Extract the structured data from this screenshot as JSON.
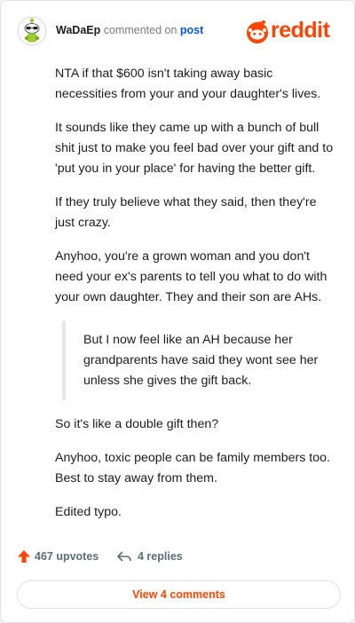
{
  "header": {
    "username": "WaDaEp",
    "action": "commented on",
    "link": "post",
    "logo_text": "reddit"
  },
  "comment": {
    "paragraphs": [
      "NTA if that $600 isn't taking away basic necessities from your and your daughter's lives.",
      "It sounds like they came up with a bunch of bull shit just to make you feel bad over your gift and to 'put you in your place' for having the better gift.",
      "If they truly believe what they said, then they're just crazy.",
      "Anyhoo, you're a grown woman and you don't need your ex's parents to tell you what to do with your own daughter. They and their son are AHs."
    ],
    "quote": "But I now feel like an AH because her grandparents have said they wont see her unless she gives the gift back.",
    "paragraphs_after": [
      "So it's like a double gift then?",
      "Anyhoo, toxic people can be family members too. Best to stay away from them.",
      "Edited typo."
    ]
  },
  "footer": {
    "upvotes": "467 upvotes",
    "replies": "4 replies"
  },
  "view_button": "View 4 comments",
  "colors": {
    "brand": "#ff4500",
    "link": "#0a58ca",
    "meta": "#576f76"
  },
  "icons": {
    "upvote": "upvote-arrow-icon",
    "reply": "reply-arrow-icon",
    "logo": "reddit-snoo-icon",
    "avatar": "snoo-avatar-icon"
  }
}
